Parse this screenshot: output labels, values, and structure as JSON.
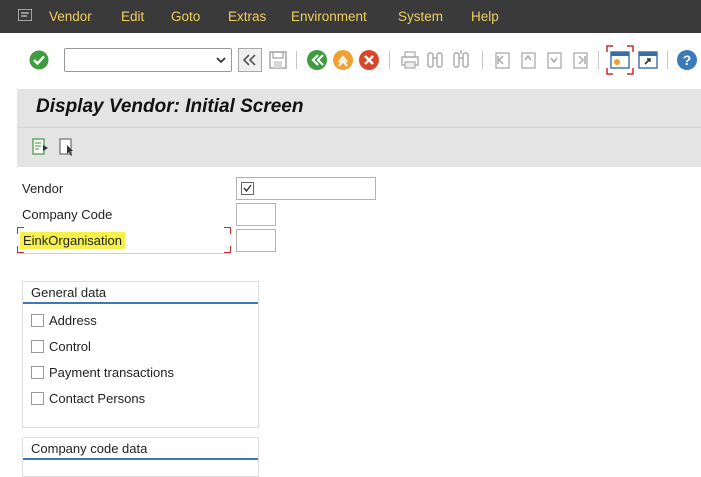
{
  "menu": {
    "items": [
      {
        "label": "Vendor"
      },
      {
        "label": "Edit"
      },
      {
        "label": "Goto"
      },
      {
        "label": "Extras"
      },
      {
        "label": "Environment"
      },
      {
        "label": "System"
      },
      {
        "label": "Help"
      }
    ]
  },
  "toolbar": {
    "command_field_value": ""
  },
  "page": {
    "title": "Display Vendor:  Initial Screen"
  },
  "form": {
    "vendor_label": "Vendor",
    "vendor_value": "",
    "company_code_label": "Company Code",
    "company_code_value": "",
    "purch_org_label": "EinkOrganisation",
    "purch_org_value": ""
  },
  "general_data": {
    "title": "General data",
    "options": [
      {
        "label": "Address",
        "checked": false
      },
      {
        "label": "Control",
        "checked": false
      },
      {
        "label": "Payment transactions",
        "checked": false
      },
      {
        "label": "Contact Persons",
        "checked": false
      }
    ]
  },
  "company_code_data": {
    "title": "Company code data"
  },
  "colors": {
    "menubar_bg": "#3a3a3a",
    "menu_text": "#f0d060",
    "title_bg": "#e4e4e4",
    "highlight": "#f5f04a",
    "group_line": "#3a7ab8",
    "focus_corner": "#c03030"
  }
}
